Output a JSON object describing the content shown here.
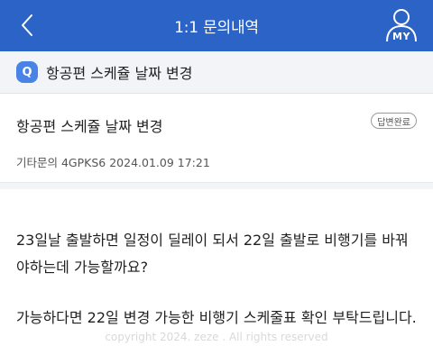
{
  "header": {
    "back_icon": "chevron-left-icon",
    "title": "1:1 문의내역",
    "my_label": "MY",
    "my_icon": "user-icon",
    "background": "#2b63c6"
  },
  "subject": {
    "badge": "Q",
    "text": "항공편 스케쥴 날짜 변경"
  },
  "inquiry": {
    "title": "항공편 스케쥴 날짜 변경",
    "status": "답변완료",
    "meta": "기타문의 4GPKS6 2024.01.09 17:21"
  },
  "content": {
    "paragraph1": "23일날 출발하면 일정이 딜레이 되서 22일 출발로 비행기를 바꿔야하는데 가능할까요?",
    "paragraph2": "가능하다면 22일 변경 가능한 비행기 스케줄표 확인 부탁드립니다."
  },
  "footer": {
    "copyright": "copyright 2024. zeze . All rights reserved"
  }
}
